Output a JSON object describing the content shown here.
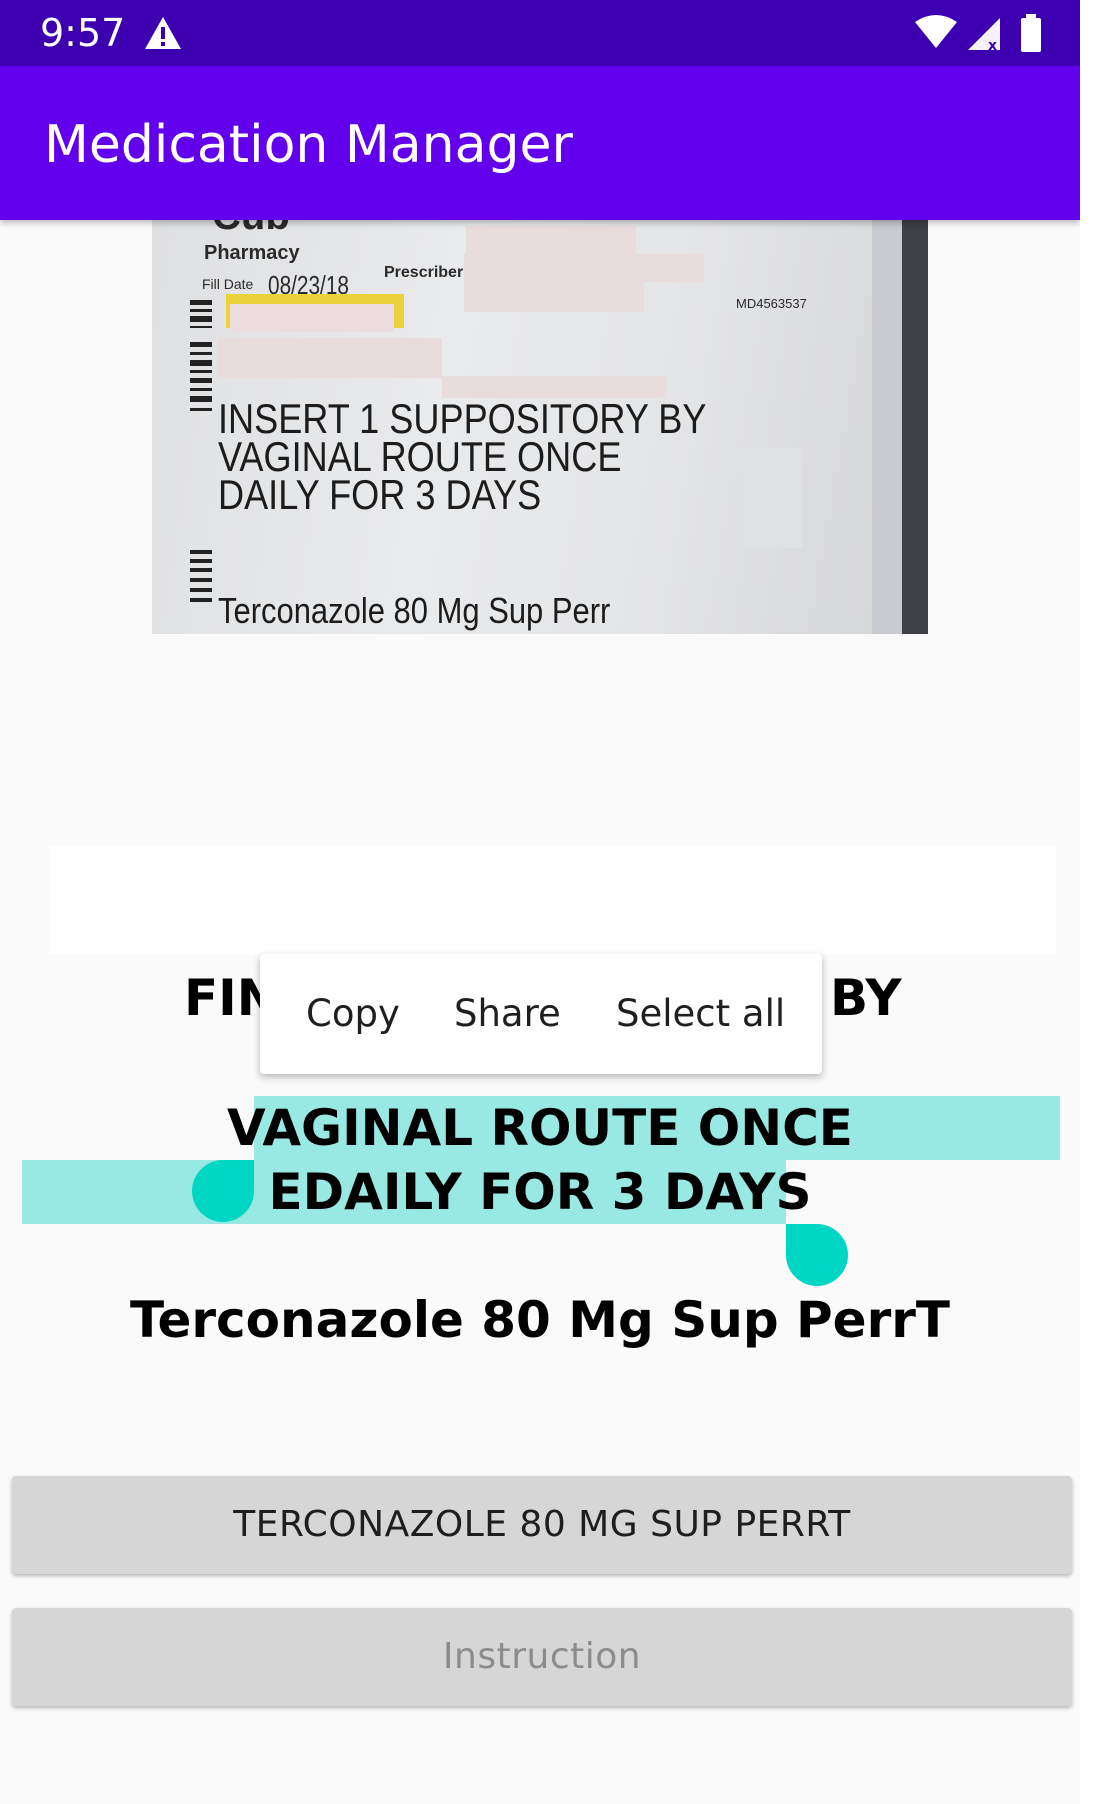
{
  "status_bar": {
    "time": "9:57",
    "icons": [
      "warning-icon",
      "wifi-icon",
      "signal-icon",
      "battery-icon"
    ],
    "background": "#3d00b0"
  },
  "app_bar": {
    "title": "Medication Manager",
    "background": "#6200ee"
  },
  "label_photo": {
    "pharmacy_name": "Cub",
    "pharmacy_sub": "Pharmacy",
    "fill_date_label": "Fill Date",
    "fill_date": "08/23/18",
    "prescriber_label": "Prescriber:",
    "rx_code": "MD4563537",
    "instruction_text": "INSERT 1 SUPPOSITORY BY\nVAGINAL ROUTE ONCE\nDAILY FOR 3 DAYS",
    "drug_text": "Terconazole 80 Mg Sup Perr"
  },
  "recognized_text": {
    "line1_left": "FIN",
    "line1_right": "BY",
    "line2": "VAGINAL ROUTE ONCE",
    "line3": "EDAILY FOR 3 DAYS",
    "line4": "Terconazole 80 Mg Sup PerrT",
    "selection_color": "#98e9e4",
    "handle_color": "#00d6c4"
  },
  "context_menu": {
    "copy": "Copy",
    "share": "Share",
    "select_all": "Select all"
  },
  "buttons": {
    "drug_name": "TERCONAZOLE 80 MG SUP PERRT",
    "instruction": "Instruction"
  }
}
